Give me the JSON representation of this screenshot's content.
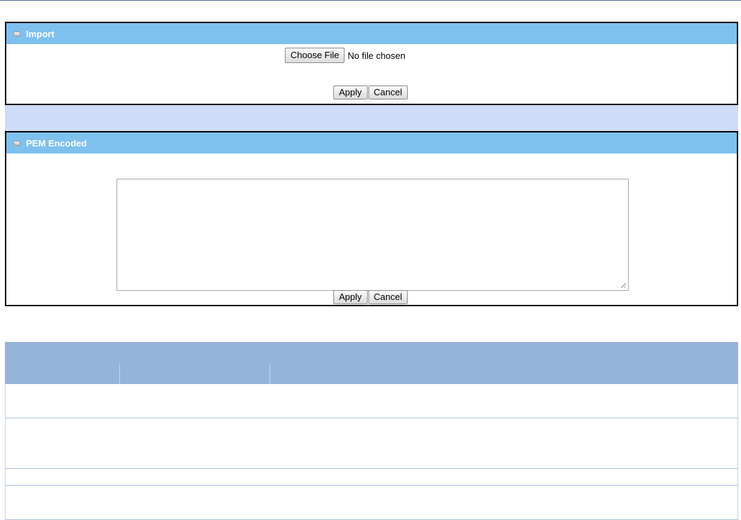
{
  "import_panel": {
    "title": "Import",
    "choose_file_label": "Choose File",
    "file_status": "No file chosen",
    "apply_label": "Apply",
    "cancel_label": "Cancel"
  },
  "pem_panel": {
    "title": "PEM Encoded",
    "textarea_value": "",
    "apply_label": "Apply",
    "cancel_label": "Cancel"
  },
  "icons": {
    "panel_header_icon": "window-icon"
  },
  "colors": {
    "panel_header": "#7ec0ee",
    "band": "#cfdcf8",
    "table_header": "#96b4d9"
  }
}
